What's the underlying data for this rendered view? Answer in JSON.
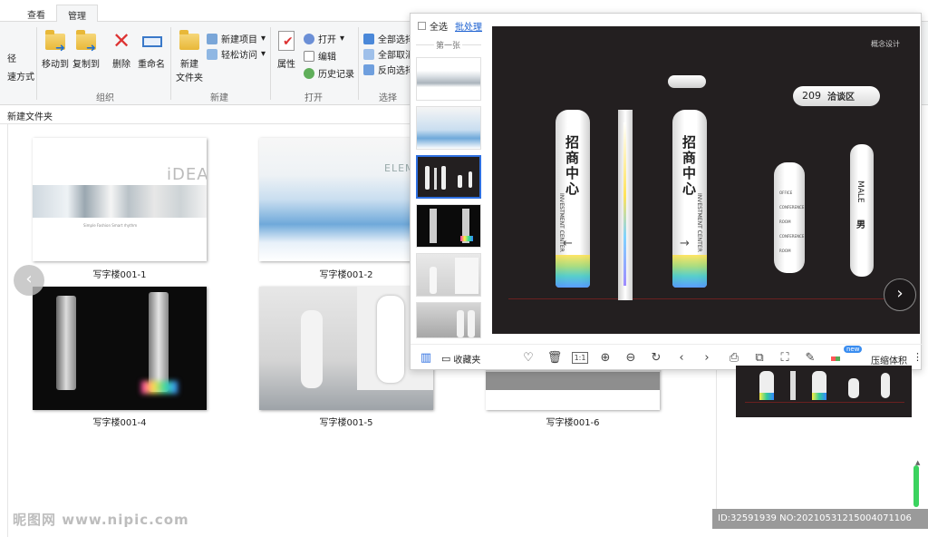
{
  "ribbon": {
    "tabs": [
      "查看",
      "管理"
    ],
    "left_partial": [
      "径",
      "速方式"
    ],
    "organize": {
      "label": "组织",
      "move_to": "移动到",
      "copy_to": "复制到",
      "delete": "删除",
      "rename": "重命名"
    },
    "new": {
      "label": "新建",
      "new_folder_1": "新建",
      "new_folder_2": "文件夹",
      "new_item": "新建项目",
      "easy_access": "轻松访问"
    },
    "open": {
      "label": "打开",
      "properties": "属性",
      "open": "打开",
      "edit": "编辑",
      "history": "历史记录"
    },
    "select": {
      "label": "选择",
      "select_all": "全部选择",
      "select_none": "全部取消",
      "invert": "反向选择"
    }
  },
  "address": {
    "path": "新建文件夹"
  },
  "files": [
    {
      "name": "写字楼001-1",
      "idea_text": "iDEA",
      "sub": "Simple Fashion    Smart rhythm"
    },
    {
      "name": "写字楼001-2",
      "elem_text": "ELEM"
    },
    {
      "name": "写字楼001-4"
    },
    {
      "name": "写字楼001-5"
    },
    {
      "name": "写字楼001-6"
    }
  ],
  "viewer": {
    "select_all": "全选",
    "batch": "批处理",
    "page_label": "第一张",
    "stage": {
      "concept": "概念设计",
      "sign_text": "招商中心",
      "sign_en": "INVESTMENT CENTER",
      "room_number": "209",
      "room_name": "洽谈区",
      "male_en": "MALE",
      "male_cn": "男",
      "office_lines": [
        "OFFICE",
        "CONFERENCE ROOM",
        "CONFERENCE ROOM"
      ]
    },
    "toolbar": {
      "favorites": "收藏夹",
      "ratio": "1:1",
      "compress": "压缩体积",
      "new_badge": "new"
    }
  },
  "watermark": {
    "site": "昵图网 www.nipic.com",
    "id_text": "ID:32591939 NO:20210531215004071106"
  },
  "colors": {
    "stage_bg": "#231f20",
    "accent_blue": "#2e6fe0",
    "link_blue": "#1a5fd0"
  }
}
